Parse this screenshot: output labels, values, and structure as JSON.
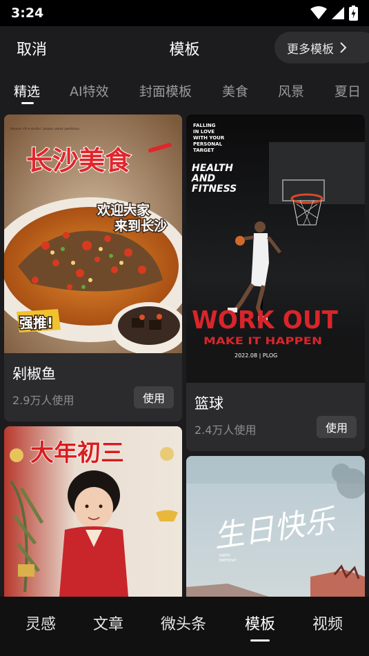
{
  "status_bar": {
    "time": "3:24",
    "icons": [
      "wifi-icon",
      "signal-icon",
      "battery-charging-icon"
    ]
  },
  "header": {
    "cancel_label": "取消",
    "title": "模板",
    "more_label": "更多模板"
  },
  "tabs": [
    {
      "label": "精选",
      "active": true
    },
    {
      "label": "AI特效",
      "active": false
    },
    {
      "label": "封面模板",
      "active": false
    },
    {
      "label": "美食",
      "active": false
    },
    {
      "label": "风景",
      "active": false
    },
    {
      "label": "夏日",
      "active": false
    }
  ],
  "templates": [
    {
      "title": "剁椒鱼",
      "usage": "2.9万人使用",
      "use_label": "使用",
      "poster": {
        "small_text": "Amuse ch'e molto' ammo amar perdona.",
        "headline": "长沙美食",
        "tagline_1": "欢迎大家",
        "tagline_2": "来到长沙",
        "badge": "强推!"
      }
    },
    {
      "title": "篮球",
      "usage": "2.4万人使用",
      "use_label": "使用",
      "poster": {
        "small_text_lines": [
          "FALLING",
          "IN LOVE",
          "WITH YOUR",
          "PERSONAL",
          "TARGET"
        ],
        "heading_lines": [
          "HEALTH",
          "AND",
          "FITNESS"
        ],
        "headline": "WORK OUT",
        "subline": "MAKE IT HAPPEN",
        "footer": "2022.08 | PLOG"
      }
    },
    {
      "title": "",
      "usage": "",
      "use_label": "",
      "poster": {
        "headline": "大年初三"
      }
    },
    {
      "title": "",
      "usage": "",
      "use_label": "",
      "poster": {
        "script": "生日快乐",
        "small_text_lines": [
          "HAPPY",
          "BIRTHDAY"
        ]
      }
    }
  ],
  "bottom_nav": [
    {
      "label": "灵感",
      "active": false
    },
    {
      "label": "文章",
      "active": false
    },
    {
      "label": "微头条",
      "active": false
    },
    {
      "label": "模板",
      "active": true
    },
    {
      "label": "视频",
      "active": false
    }
  ],
  "colors": {
    "background": "#1c1c1e",
    "card": "#2b2b2d",
    "button": "#404043",
    "text_secondary": "#8e8e90",
    "poster_red": "#e0262b"
  }
}
